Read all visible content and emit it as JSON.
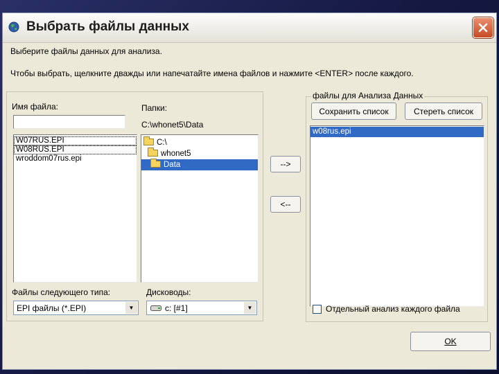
{
  "dialog": {
    "title": "Выбрать файлы данных",
    "instruction1": "Выберите файлы данных для анализа.",
    "instruction2": "Чтобы выбрать, щелкните дважды или напечатайте имена файлов и нажмите <ENTER> после каждого."
  },
  "left": {
    "filename_label": "Имя файла:",
    "filename_value": "",
    "files": [
      "W07RUS.EPI",
      "W08RUS.EPI",
      "wroddom07rus.epi"
    ],
    "folders_label": "Папки:",
    "current_path": "C:\\whonet5\\Data",
    "folders": [
      "C:\\",
      "whonet5",
      "Data"
    ],
    "filetype_label": "Файлы следующего типа:",
    "filetype_value": "EPI файлы (*.EPI)",
    "drives_label": "Дисководы:",
    "drive_value": "c: [#1]"
  },
  "middle": {
    "add_button": "-->",
    "remove_button": "<--"
  },
  "right": {
    "group_label": "файлы для Анализа Данных",
    "save_list_button": "Сохранить список",
    "clear_list_button": "Стереть список",
    "selected_files": [
      "w08rus.epi"
    ],
    "separate_analysis_label": "Отдельный анализ каждого файла",
    "separate_analysis_checked": false
  },
  "ok_button": "OK",
  "icons": {
    "app": "globe-icon",
    "close": "close-icon",
    "folder": "folder-icon",
    "drive": "drive-icon",
    "dropdown": "chevron-down-icon"
  },
  "colors": {
    "selection": "#316AC5",
    "dialog_bg": "#ECE9D8",
    "close_button": "#D4532A"
  }
}
